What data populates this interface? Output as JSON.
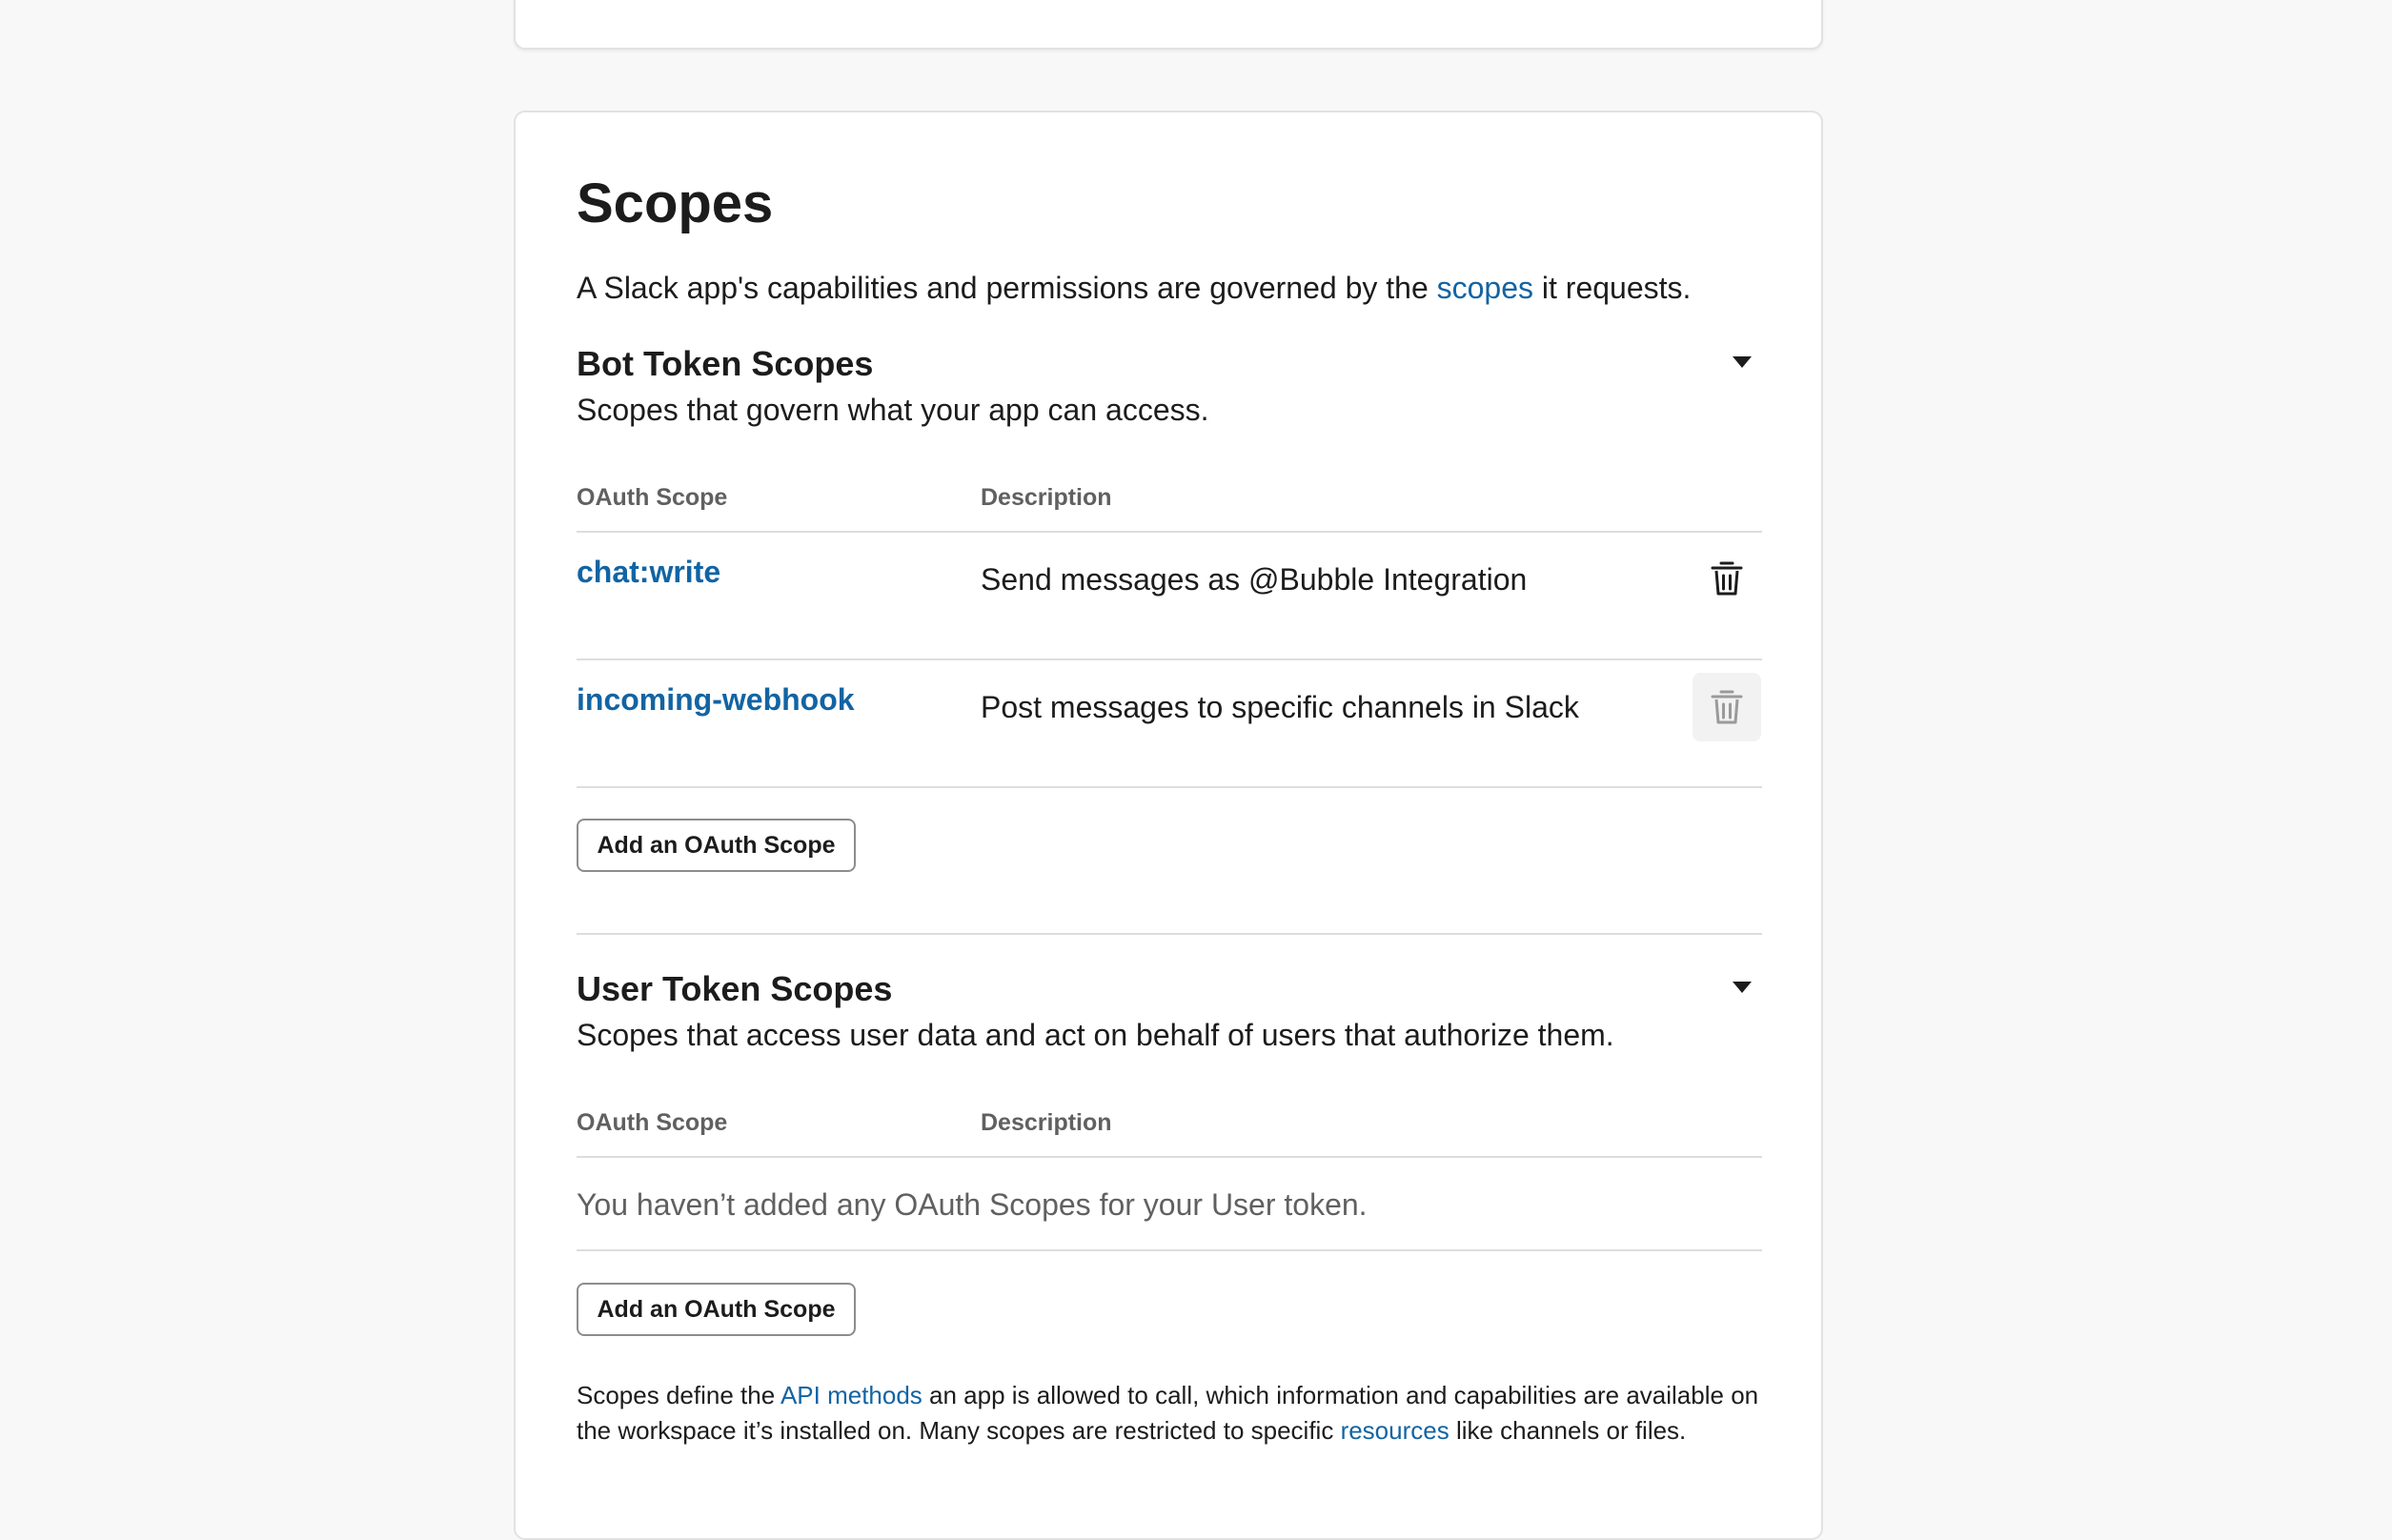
{
  "scopes": {
    "title": "Scopes",
    "intro": {
      "before": "A Slack app's capabilities and permissions are governed by the ",
      "link": "scopes",
      "after": " it requests."
    }
  },
  "bot": {
    "title": "Bot Token Scopes",
    "subtitle": "Scopes that govern what your app can access.",
    "col_scope": "OAuth Scope",
    "col_desc": "Description",
    "rows": [
      {
        "scope": "chat:write",
        "description": "Send messages as @Bubble Integration"
      },
      {
        "scope": "incoming-webhook",
        "description": "Post messages to specific channels in Slack"
      }
    ],
    "add_button": "Add an OAuth Scope"
  },
  "user": {
    "title": "User Token Scopes",
    "subtitle": "Scopes that access user data and act on behalf of users that authorize them.",
    "col_scope": "OAuth Scope",
    "col_desc": "Description",
    "empty": "You haven’t added any OAuth Scopes for your User token.",
    "add_button": "Add an OAuth Scope"
  },
  "footer": {
    "t1": "Scopes define the ",
    "link1": "API methods",
    "t2": " an app is allowed to call, which information and capabilities are available on the workspace it’s installed on. Many scopes are restricted to specific ",
    "link2": "resources",
    "t3": " like channels or files."
  },
  "icons": {
    "collapse": "caret-down-icon",
    "remove": "trash-icon"
  },
  "colors": {
    "link": "#1264a3",
    "background": "#f8f8f8",
    "card": "#ffffff",
    "muted_text": "#616061"
  }
}
